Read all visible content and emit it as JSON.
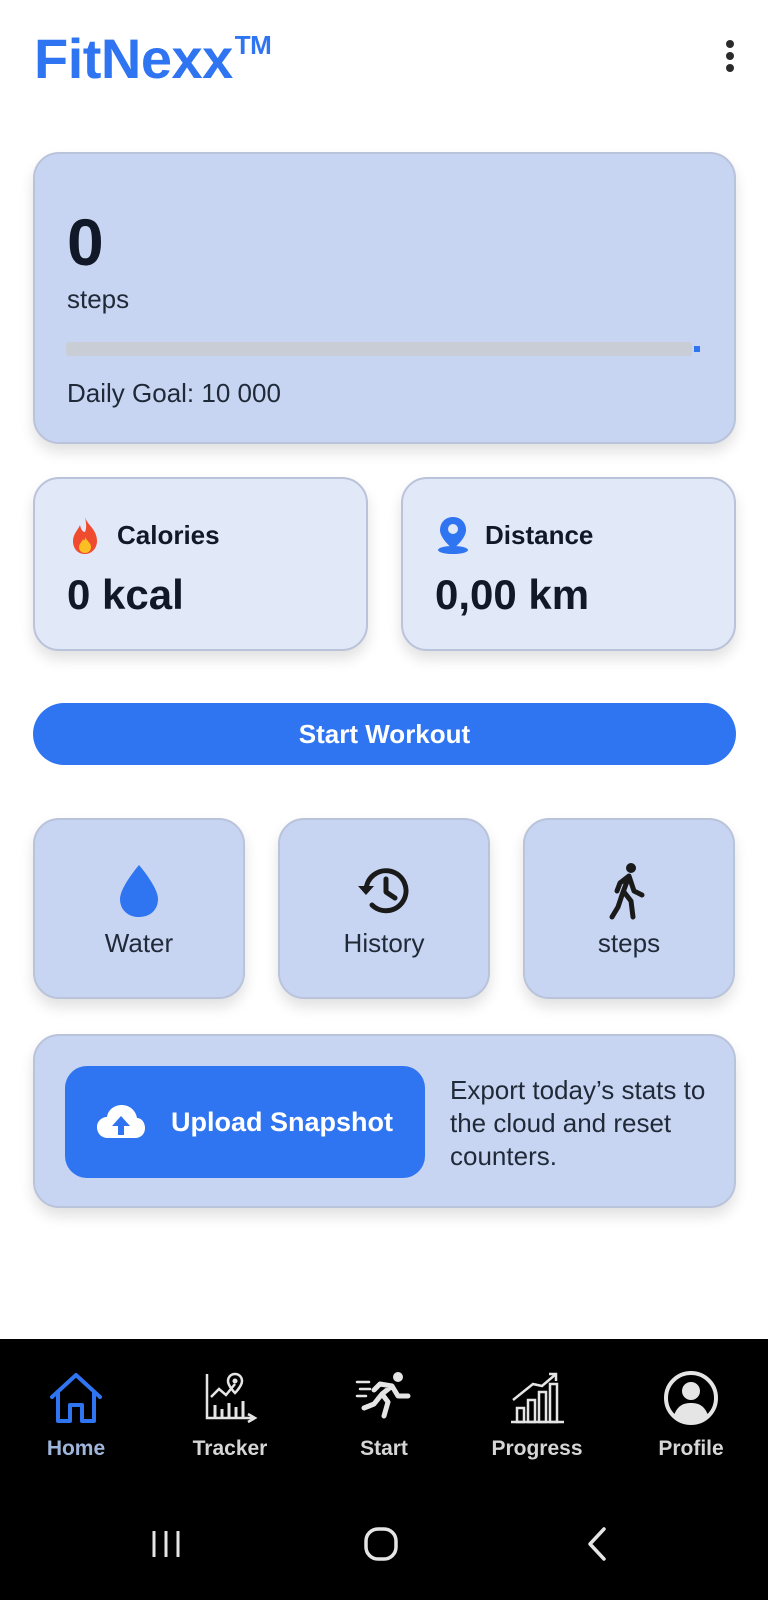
{
  "app": {
    "title": "FitNexx",
    "trademark": "TM"
  },
  "steps_card": {
    "count": "0",
    "label": "steps",
    "progress": 0.0,
    "goal_text": "Daily Goal: 10 000"
  },
  "calories": {
    "title": "Calories",
    "value": "0 kcal",
    "icon": "flame-icon"
  },
  "distance": {
    "title": "Distance",
    "value": "0,00 km",
    "icon": "location-pin-icon"
  },
  "start_button": {
    "label": "Start Workout"
  },
  "tiles": [
    {
      "label": "Water",
      "icon": "water-drop-icon"
    },
    {
      "label": "History",
      "icon": "history-icon"
    },
    {
      "label": "steps",
      "icon": "walking-icon"
    }
  ],
  "upload": {
    "button_label": "Upload Snapshot",
    "description": "Export today’s stats to the cloud and reset counters."
  },
  "nav": {
    "items": [
      {
        "label": "Home",
        "icon": "home-icon",
        "active": true
      },
      {
        "label": "Tracker",
        "icon": "tracker-chart-icon",
        "active": false
      },
      {
        "label": "Start",
        "icon": "running-icon",
        "active": false
      },
      {
        "label": "Progress",
        "icon": "bar-chart-icon",
        "active": false
      },
      {
        "label": "Profile",
        "icon": "profile-icon",
        "active": false
      }
    ]
  },
  "colors": {
    "accent": "#2f74f0",
    "card": "#c8d5f2",
    "mini_card": "#e1e8f7",
    "nav_bg": "#000000"
  }
}
